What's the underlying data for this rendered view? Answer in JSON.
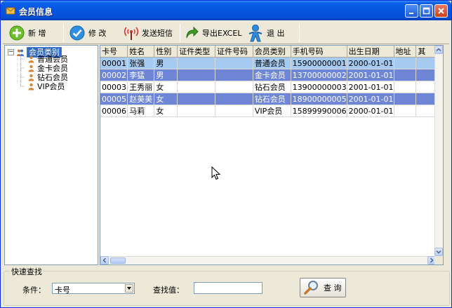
{
  "window": {
    "title": "会员信息"
  },
  "toolbar": {
    "add_label": "新 增",
    "edit_label": "修 改",
    "sms_label": "发送短信",
    "excel_label": "导出EXCEL",
    "exit_label": "退 出"
  },
  "tree": {
    "root_label": "会员类别",
    "children": [
      "普通会员",
      "金卡会员",
      "钻石会员",
      "VIP会员"
    ]
  },
  "table": {
    "columns": [
      "卡号",
      "姓名",
      "性别",
      "证件类型",
      "证件号码",
      "会员类别",
      "手机号码",
      "出生日期",
      "地址",
      "其"
    ],
    "rows": [
      [
        "00001",
        "张强",
        "男",
        "",
        "",
        "普通会员",
        "15900000001",
        "2000-01-01",
        "",
        ""
      ],
      [
        "00002",
        "李猛",
        "男",
        "",
        "",
        "金卡会员",
        "13700000002",
        "2001-01-01",
        "",
        ""
      ],
      [
        "00003",
        "王秀丽",
        "女",
        "",
        "",
        "钻石会员",
        "13900000003",
        "2001-01-01",
        "",
        ""
      ],
      [
        "00005",
        "赵美美",
        "女",
        "",
        "",
        "钻石会员",
        "18900000005",
        "2001-01-01",
        "",
        ""
      ],
      [
        "00006",
        "马莉",
        "女",
        "",
        "",
        "VIP会员",
        "15899990006",
        "2000-01-01",
        "",
        ""
      ]
    ]
  },
  "quick_search": {
    "title": "快速查找",
    "condition_label": "条件：",
    "condition_value": "卡号",
    "find_label": "查找值：",
    "find_value": "",
    "query_label": "查 询"
  }
}
